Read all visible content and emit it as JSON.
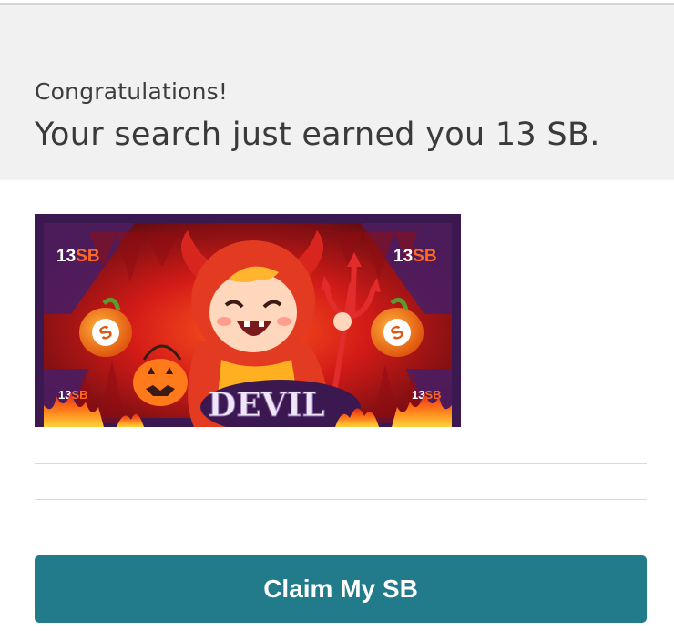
{
  "header": {
    "congrats_text": "Congratulations!",
    "earned_text": "Your search just earned you 13 SB."
  },
  "banner": {
    "title": "DEVIL",
    "corner_amount": "13",
    "corner_unit": "SB"
  },
  "claim": {
    "button_label": "Claim My SB"
  },
  "colors": {
    "header_bg": "#f1f1f1",
    "button_bg": "#227b8a",
    "banner_frame": "#3b1850",
    "banner_red": "#c2161a",
    "sb_orange": "#ff6a1f"
  },
  "icons": [
    "devil-character-illustration",
    "pitchfork-icon",
    "jack-o-lantern-icon",
    "sb-pumpkin-coin-icon",
    "flames-decoration"
  ]
}
